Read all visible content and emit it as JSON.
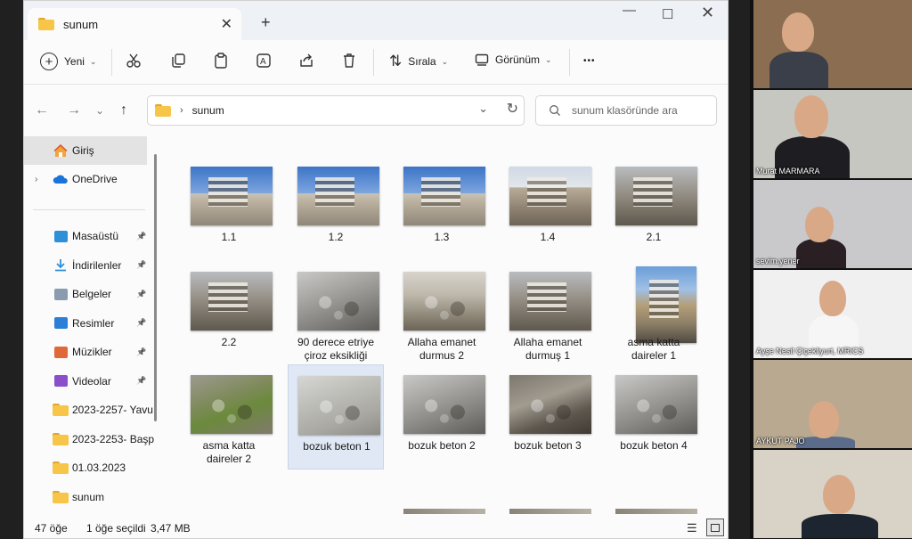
{
  "window": {
    "tab_title": "sunum",
    "tab_close": "✕",
    "new_tab": "+",
    "minimize": "—",
    "maximize": "☐",
    "close": "✕"
  },
  "toolbar": {
    "new_label": "Yeni",
    "sort_label": "Sırala",
    "view_label": "Görünüm",
    "more": "•••",
    "icons": [
      "cut-icon",
      "copy-icon",
      "paste-icon",
      "rename-icon",
      "share-icon",
      "delete-icon"
    ]
  },
  "address": {
    "path": "sunum",
    "separator": "›",
    "search_placeholder": "sunum klasöründe ara"
  },
  "sidebar": {
    "home": "Giriş",
    "onedrive": "OneDrive",
    "items": [
      {
        "label": "Masaüstü",
        "icon": "desktop-icon",
        "color": "#2f8fd8",
        "pinned": true
      },
      {
        "label": "İndirilenler",
        "icon": "download-icon",
        "color": "#2f8fd8",
        "pinned": true
      },
      {
        "label": "Belgeler",
        "icon": "documents-icon",
        "color": "#8a9bb0",
        "pinned": true
      },
      {
        "label": "Resimler",
        "icon": "pictures-icon",
        "color": "#2c7fd6",
        "pinned": true
      },
      {
        "label": "Müzikler",
        "icon": "music-icon",
        "color": "#e0673a",
        "pinned": true
      },
      {
        "label": "Videolar",
        "icon": "videos-icon",
        "color": "#8b4fc9",
        "pinned": true
      },
      {
        "label": "2023-2257- Yavu",
        "icon": "folder-icon",
        "color": "#f7c548",
        "pinned": false
      },
      {
        "label": "2023-2253- Başp",
        "icon": "folder-icon",
        "color": "#f7c548",
        "pinned": false
      },
      {
        "label": "01.03.2023",
        "icon": "folder-icon",
        "color": "#f7c548",
        "pinned": false
      },
      {
        "label": "sunum",
        "icon": "folder-icon",
        "color": "#f7c548",
        "pinned": false
      }
    ]
  },
  "files": [
    {
      "label": "1.1",
      "style": "building-sky"
    },
    {
      "label": "1.2",
      "style": "building-sky"
    },
    {
      "label": "1.3",
      "style": "building-sky"
    },
    {
      "label": "1.4",
      "style": "building-collapse"
    },
    {
      "label": "2.1",
      "style": "building-grey"
    },
    {
      "label": "2.2",
      "style": "building-grey"
    },
    {
      "label": "90 derece etriye\nçiroz eksikliği",
      "style": "rubble-grey"
    },
    {
      "label": "Allaha emanet\ndurmus 2",
      "style": "interior"
    },
    {
      "label": "Allaha emanet\ndurmuş 1",
      "style": "building-grey"
    },
    {
      "label": "asma katta\ndaireler 1",
      "style": "street-tall"
    },
    {
      "label": "asma katta\ndaireler 2",
      "style": "water"
    },
    {
      "label": "bozuk beton 1",
      "style": "concrete",
      "selected": true
    },
    {
      "label": "bozuk beton 2",
      "style": "rubble-grey"
    },
    {
      "label": "bozuk beton 3",
      "style": "rubble-dark"
    },
    {
      "label": "bozuk beton 4",
      "style": "rubble-grey"
    }
  ],
  "status": {
    "count": "47 öğe",
    "selected": "1 öğe seçildi",
    "size": "3,47 MB"
  },
  "participants": [
    {
      "name": "",
      "bg": "#8b6e52"
    },
    {
      "name": "Murat MARMARA",
      "bg": "#c7c7c2"
    },
    {
      "name": "sevim.yener",
      "bg": "#c9c9cc"
    },
    {
      "name": "Ayşe Nesil Çiçekliyurt, MRICS",
      "bg": "#f0f0f0"
    },
    {
      "name": "AYKUT PAJO",
      "bg": "#b8a990"
    },
    {
      "name": "",
      "bg": "#d8d3c6"
    }
  ]
}
